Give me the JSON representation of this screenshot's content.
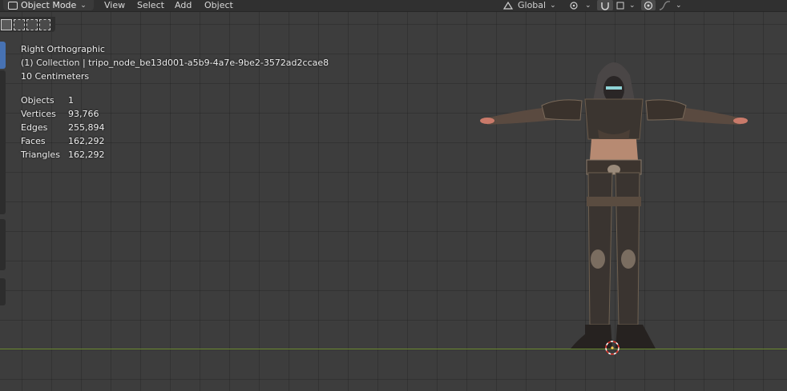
{
  "header": {
    "mode_label": "Object Mode",
    "menus": [
      "View",
      "Select",
      "Add",
      "Object"
    ],
    "orientation_label": "Global"
  },
  "overlay": {
    "view_name": "Right Orthographic",
    "collection": "(1) Collection | tripo_node_be13d001-a5b9-4a7e-9be2-3572ad2ccae8",
    "scale": "10 Centimeters"
  },
  "stats": [
    {
      "label": "Objects",
      "value": "1"
    },
    {
      "label": "Vertices",
      "value": "93,766"
    },
    {
      "label": "Edges",
      "value": "255,894"
    },
    {
      "label": "Faces",
      "value": "162,292"
    },
    {
      "label": "Triangles",
      "value": "162,292"
    }
  ],
  "colors": {
    "viewport_bg": "#3d3d3d",
    "ground_line": "#6f8f32",
    "active_tool": "#4772b3",
    "cursor_red": "#d9352b"
  },
  "icons": [
    "object-mode-icon",
    "chevron-down-icon",
    "transform-orientation-icon",
    "pivot-icon",
    "snap-icon",
    "proportional-edit-icon",
    "select-box-icon",
    "3d-cursor-icon"
  ]
}
